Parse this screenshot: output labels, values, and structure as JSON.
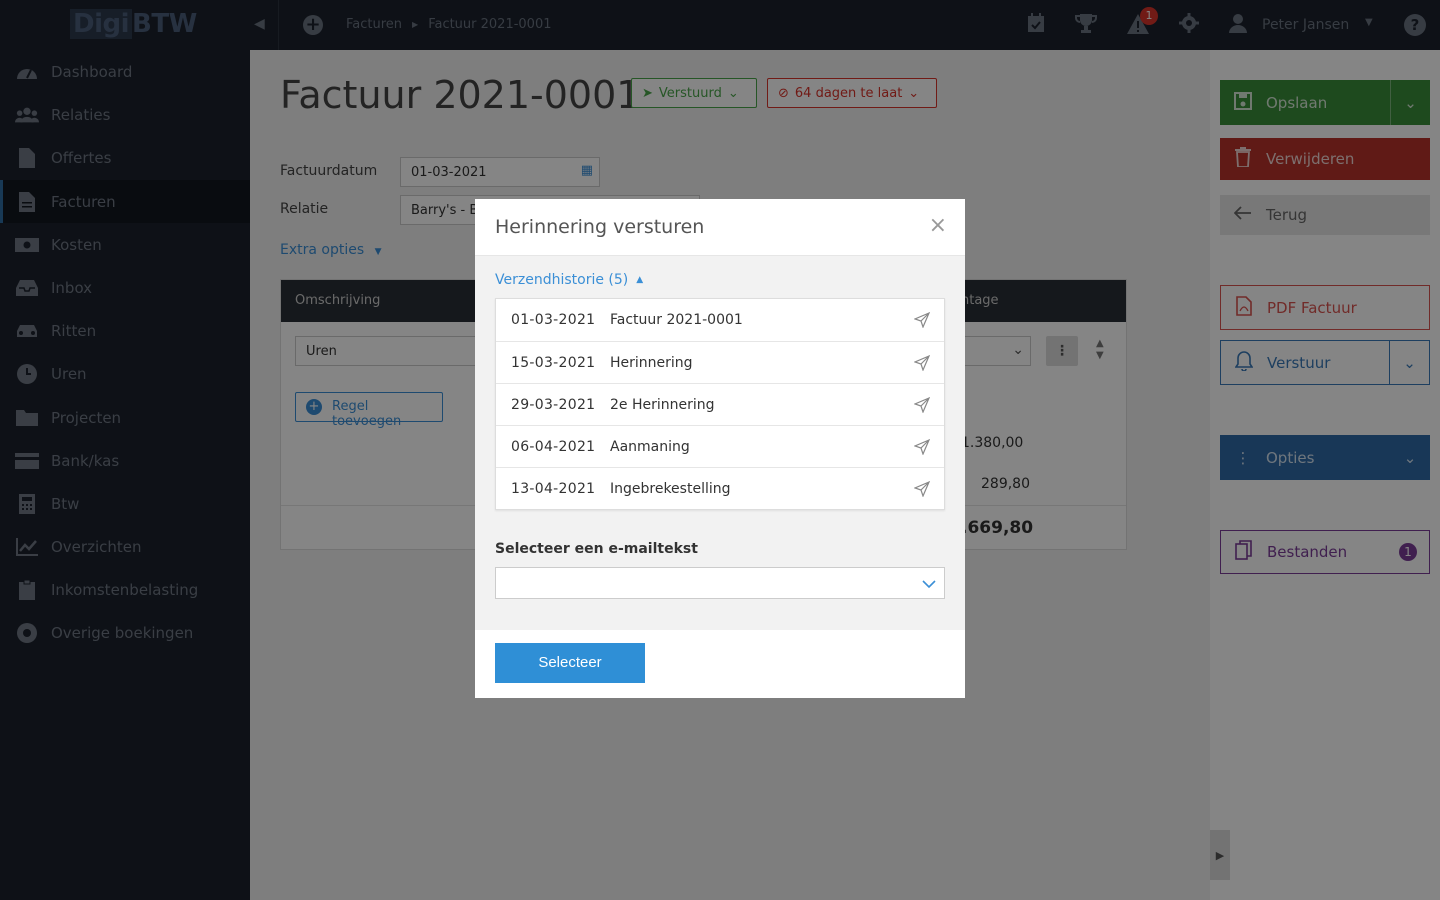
{
  "app": {
    "logo_part1": "Digi",
    "logo_part2": "BTW"
  },
  "topbar": {
    "breadcrumbs": [
      "Facturen",
      "Factuur 2021-0001"
    ],
    "alert_count": "1",
    "user_name": "Peter Jansen"
  },
  "sidebar": {
    "items": [
      {
        "label": "Dashboard",
        "icon": "dashboard-icon"
      },
      {
        "label": "Relaties",
        "icon": "users-icon"
      },
      {
        "label": "Offertes",
        "icon": "file-icon"
      },
      {
        "label": "Facturen",
        "icon": "file-text-icon",
        "active": true
      },
      {
        "label": "Kosten",
        "icon": "money-icon"
      },
      {
        "label": "Inbox",
        "icon": "inbox-icon"
      },
      {
        "label": "Ritten",
        "icon": "car-icon"
      },
      {
        "label": "Uren",
        "icon": "clock-icon"
      },
      {
        "label": "Projecten",
        "icon": "folder-icon"
      },
      {
        "label": "Bank/kas",
        "icon": "credit-card-icon"
      },
      {
        "label": "Btw",
        "icon": "calculator-icon"
      },
      {
        "label": "Overzichten",
        "icon": "chart-icon"
      },
      {
        "label": "Inkomstenbelasting",
        "icon": "clipboard-icon"
      },
      {
        "label": "Overige boekingen",
        "icon": "lifebuoy-icon"
      }
    ]
  },
  "invoice": {
    "title": "Factuur 2021-0001",
    "status_sent": "Verstuurd",
    "status_late": "64 dagen te laat",
    "date_label": "Factuurdatum",
    "date_value": "01-03-2021",
    "relation_label": "Relatie",
    "relation_value": "Barry's - Bl",
    "extra_options": "Extra opties",
    "table_header_desc": "Omschrijving",
    "table_header_right": "ntage",
    "row_desc": "Uren",
    "add_row": "Regel toevoegen",
    "amount_1": "1.380,00",
    "amount_2": "289,80",
    "amount_total": ".669,80"
  },
  "actions": {
    "save": "Opslaan",
    "delete": "Verwijderen",
    "back": "Terug",
    "pdf": "PDF Factuur",
    "send": "Verstuur",
    "options": "Opties",
    "files": "Bestanden",
    "files_count": "1"
  },
  "modal": {
    "title": "Herinnering versturen",
    "close": "×",
    "history_toggle": "Verzendhistorie (5)",
    "history": [
      {
        "date": "01-03-2021",
        "description": "Factuur 2021-0001"
      },
      {
        "date": "15-03-2021",
        "description": "Herinnering"
      },
      {
        "date": "29-03-2021",
        "description": "2e Herinnering"
      },
      {
        "date": "06-04-2021",
        "description": "Aanmaning"
      },
      {
        "date": "13-04-2021",
        "description": "Ingebrekestelling"
      }
    ],
    "email_label": "Selecteer een e-mailtekst",
    "email_value": "",
    "submit": "Selecteer"
  },
  "colors": {
    "accent": "#2f8fd6",
    "link": "#3b8fd6",
    "sidebar_bg": "#1b212c",
    "save": "#3a8f3a",
    "delete": "#b8332b",
    "options": "#2e6aa8",
    "files": "#7b3d98"
  }
}
